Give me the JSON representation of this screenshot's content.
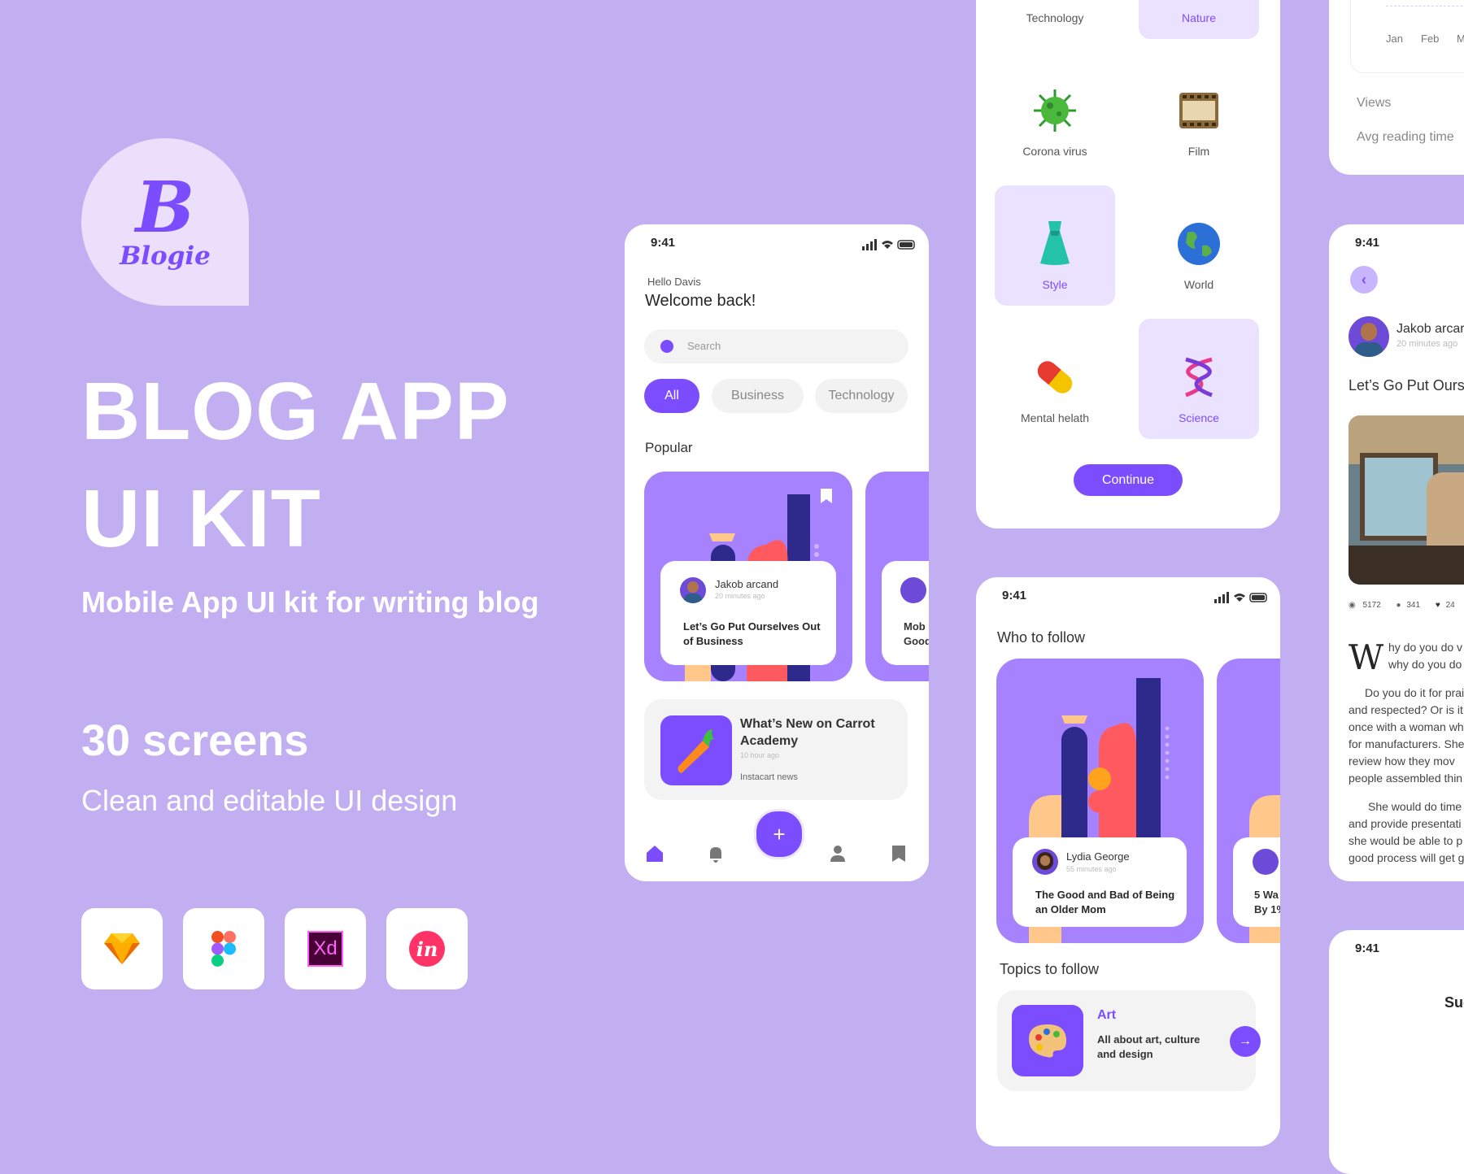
{
  "hero": {
    "logo_letter": "B",
    "logo_word": "Blogie",
    "title_line1": "BLOG APP",
    "title_line2": "UI KIT",
    "subtitle": "Mobile App UI kit for writing blog",
    "screens": "30 screens",
    "tagline": "Clean and editable UI design",
    "tools": [
      "sketch-icon",
      "figma-icon",
      "xd-icon",
      "invision-icon"
    ],
    "xd_text": "Xd",
    "invision_text": "in"
  },
  "home": {
    "time": "9:41",
    "greeting": "Hello Davis",
    "welcome": "Welcome back!",
    "search_placeholder": "Search",
    "chips": [
      "All",
      "Business",
      "Technology"
    ],
    "popular_label": "Popular",
    "card1": {
      "author": "Jakob arcand",
      "time": "20 minutes ago",
      "title": "Let’s Go Put Ourselves Out of Business"
    },
    "card2": {
      "title_partial": "Mob",
      "title_partial2": "Good"
    },
    "news": {
      "title": "What’s New on Carrot Academy",
      "time": "10 hour ago",
      "source": "Instacart news"
    },
    "fab": "+"
  },
  "topics": {
    "items": [
      {
        "label": "Technology",
        "selected": false
      },
      {
        "label": "Nature",
        "selected": true
      },
      {
        "label": "Corona virus",
        "selected": false
      },
      {
        "label": "Film",
        "selected": false
      },
      {
        "label": "Style",
        "selected": true
      },
      {
        "label": "World",
        "selected": false
      },
      {
        "label": "Mental helath",
        "selected": false
      },
      {
        "label": "Science",
        "selected": true
      }
    ],
    "continue_label": "Continue"
  },
  "follow": {
    "time": "9:41",
    "who_label": "Who to follow",
    "card1": {
      "author": "Lydia George",
      "time": "55 minutes ago",
      "title": "The Good and Bad of Being an Older Mom"
    },
    "card2": {
      "title_partial": "5 Wa",
      "title_partial2": "By 1%"
    },
    "topics_label": "Topics to follow",
    "topic": {
      "name": "Art",
      "desc": "All about art, culture and design"
    }
  },
  "stats": {
    "months": [
      "Jan",
      "Feb",
      "M"
    ],
    "views_label": "Views",
    "reading_label": "Avg reading time"
  },
  "article": {
    "time": "9:41",
    "author": "Jakob arcar",
    "author_time": "20 minutes ago",
    "title": "Let’s Go Put Ours",
    "views": "5172",
    "comments": "341",
    "likes": "24",
    "dropcap": "W",
    "lead1": "hy do you do v",
    "lead2": "why do you do",
    "p1": [
      "Do you do it for prai",
      "and respected? Or is it",
      "once with a woman wh",
      "for manufacturers. She",
      "review how they mov",
      "people assembled thin"
    ],
    "p2": [
      "She would do time",
      "and provide presentati",
      "she would be able to p",
      "good process will get g"
    ]
  },
  "bottom": {
    "time": "9:41",
    "partial": "Suc"
  }
}
